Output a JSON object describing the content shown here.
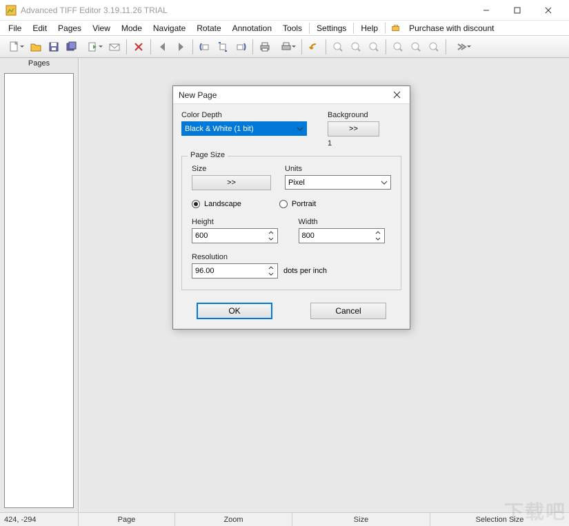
{
  "window": {
    "title": "Advanced TIFF Editor 3.19.11.26 TRIAL"
  },
  "menu": {
    "items": [
      "File",
      "Edit",
      "Pages",
      "View",
      "Mode",
      "Navigate",
      "Rotate",
      "Annotation",
      "Tools",
      "Settings",
      "Help"
    ],
    "purchase": "Purchase with discount"
  },
  "pages_panel": {
    "header": "Pages"
  },
  "statusbar": {
    "coords": "424, -294",
    "page_label": "Page",
    "zoom_label": "Zoom",
    "size_label": "Size",
    "selection_label": "Selection Size"
  },
  "dialog": {
    "title": "New Page",
    "color_depth_label": "Color Depth",
    "color_depth_value": "Black & White (1 bit)",
    "background_label": "Background",
    "background_btn": ">>",
    "background_value": "1",
    "pagesize_legend": "Page Size",
    "size_label": "Size",
    "size_btn": ">>",
    "units_label": "Units",
    "units_value": "Pixel",
    "landscape_label": "Landscape",
    "portrait_label": "Portrait",
    "height_label": "Height",
    "height_value": "600",
    "width_label": "Width",
    "width_value": "800",
    "resolution_label": "Resolution",
    "resolution_value": "96.00",
    "dpi_suffix": "dots per inch",
    "ok": "OK",
    "cancel": "Cancel"
  }
}
